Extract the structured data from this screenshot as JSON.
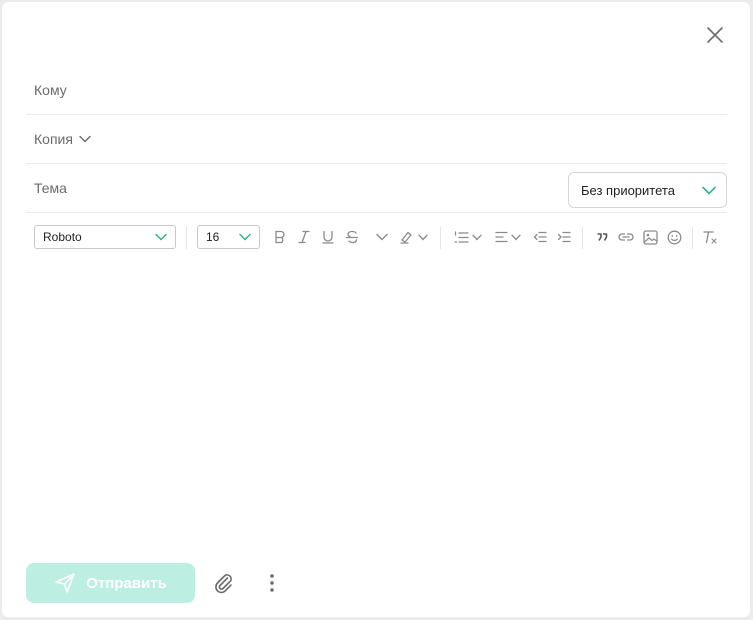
{
  "compose": {
    "to_label": "Кому",
    "cc_label": "Копия",
    "subject_label": "Тема",
    "priority": {
      "selected": "Без приоритета"
    }
  },
  "toolbar": {
    "font_family": "Roboto",
    "font_size": "16"
  },
  "footer": {
    "send_label": "Отправить"
  },
  "colors": {
    "accent": "#2bb58d",
    "send_disabled_bg": "#bcefe2",
    "icon": "#8a8a8a"
  }
}
